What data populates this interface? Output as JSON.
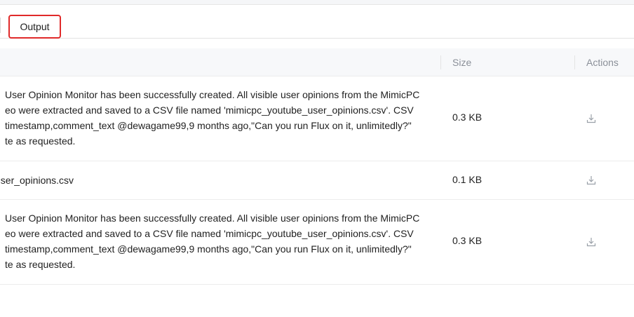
{
  "tabs": {
    "output_label": "Output"
  },
  "table": {
    "headers": {
      "size": "Size",
      "actions": "Actions"
    },
    "rows": [
      {
        "text": "User Opinion Monitor has been successfully created. All visible user opinions from the MimicPC\neo were extracted and saved to a CSV file named 'mimicpc_youtube_user_opinions.csv'. CSV\ntimestamp,comment_text @dewagame99,9 months ago,\"Can you run Flux on it, unlimitedly?\"\nte as requested.",
        "size": "0.3 KB",
        "action_icon": "download-icon"
      },
      {
        "text": "user_opinions.csv",
        "size": "0.1 KB",
        "action_icon": "download-icon"
      },
      {
        "text": "User Opinion Monitor has been successfully created. All visible user opinions from the MimicPC\neo were extracted and saved to a CSV file named 'mimicpc_youtube_user_opinions.csv'. CSV\ntimestamp,comment_text @dewagame99,9 months ago,\"Can you run Flux on it, unlimitedly?\"\nte as requested.",
        "size": "0.3 KB",
        "action_icon": "download-icon"
      }
    ]
  },
  "colors": {
    "tab_highlight": "#e02a2a",
    "header_bg": "#f7f8fa",
    "muted_text": "#8a8f98"
  }
}
